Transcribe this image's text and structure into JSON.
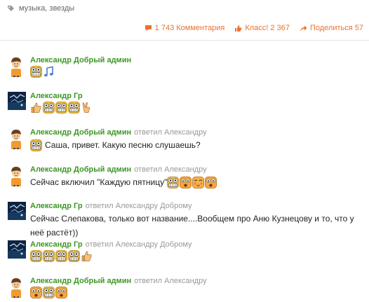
{
  "tags": {
    "icon": "tag-icon",
    "text": "музыка, звезды"
  },
  "stats": {
    "comments": {
      "icon": "comment-icon",
      "label": "1 743 Комментария"
    },
    "likes": {
      "icon": "like-icon",
      "label": "Класс! 2 367"
    },
    "shares": {
      "icon": "share-icon",
      "label": "Поделиться 57"
    },
    "accent": "#eb722e"
  },
  "colors": {
    "author": "#3d9625",
    "reply": "#999999"
  },
  "comments": [
    {
      "author": "Александр Добрый админ",
      "reply": "",
      "text": "",
      "emojis": [
        "laugh",
        "music-note"
      ],
      "avatar": "boy"
    },
    {
      "author": "Александр Гр",
      "reply": "",
      "text": "",
      "emojis": [
        "thumbs-up",
        "laugh",
        "laugh",
        "laugh",
        "victory"
      ],
      "avatar": "photo"
    },
    {
      "author": "Александр Добрый админ",
      "reply": "ответил Александру",
      "text": "Саша, привет. Какую песню слушаешь?",
      "emojis": [
        "laugh"
      ],
      "avatar": "boy"
    },
    {
      "author": "Александр Добрый админ",
      "reply": "ответил Александру",
      "text": "Сейчас включил \"Каждую пятницу\"",
      "emojis": [
        "laugh",
        "shocked",
        "blush",
        "shocked"
      ],
      "avatar": "boy"
    },
    {
      "author": "Александр Гр",
      "reply": "ответил Александру Доброму",
      "text": "Сейчас Слепакова, только вот название....Вообщем про Аню Кузнецову и то, что у неё растёт))",
      "emojis": [],
      "avatar": "photo"
    },
    {
      "author": "Александр Гр",
      "reply": "ответил Александру Доброму",
      "text": "",
      "emojis": [
        "laugh",
        "laugh",
        "laugh",
        "laugh",
        "thumbs-up"
      ],
      "avatar": "photo"
    },
    {
      "author": "Александр Добрый админ",
      "reply": "ответил Александру",
      "text": "",
      "emojis": [
        "shocked",
        "laugh",
        "shocked"
      ],
      "avatar": "boy"
    }
  ]
}
